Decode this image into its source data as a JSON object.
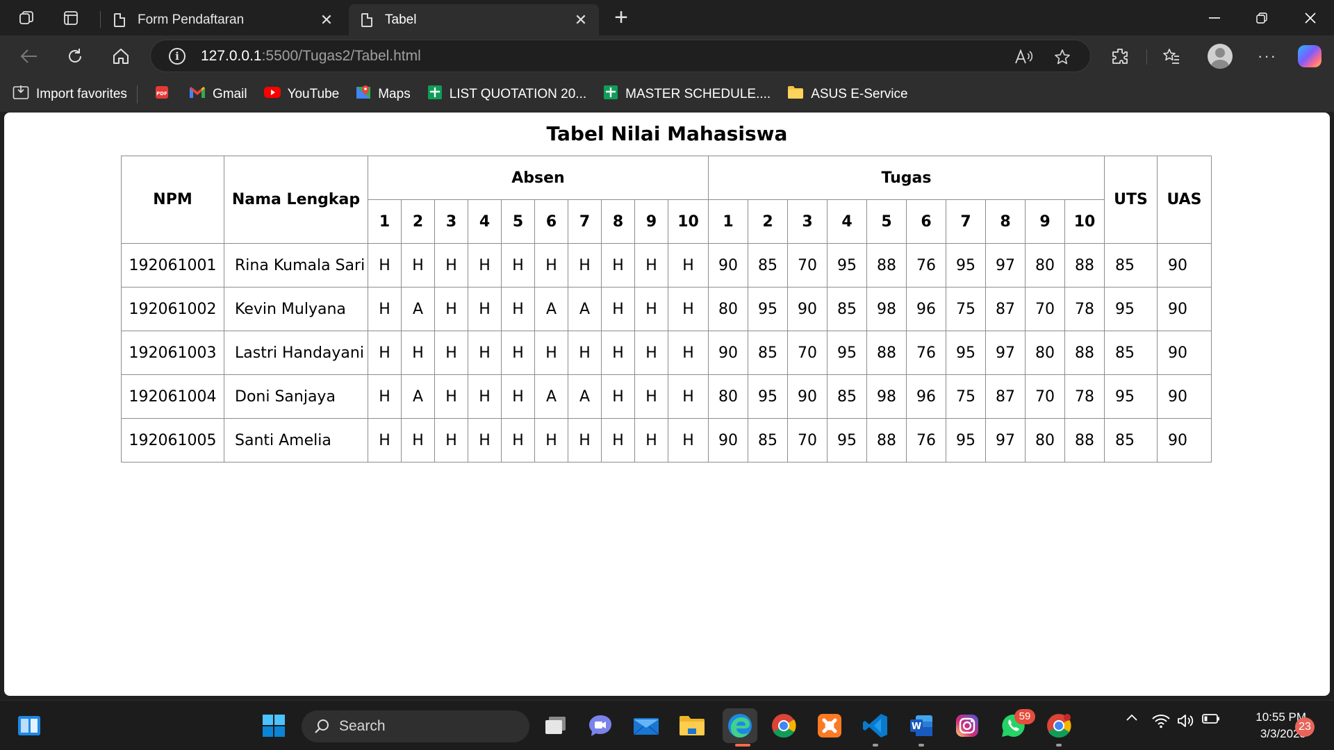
{
  "browser": {
    "tabs": [
      {
        "title": "Form Pendaftaran",
        "close": "✕"
      },
      {
        "title": "Tabel",
        "close": "✕"
      }
    ],
    "new_tab": "+",
    "address": {
      "host": "127.0.0.1",
      "path": ":5500/Tugas2/Tabel.html"
    },
    "window_controls": {
      "minimize": "—",
      "restore": "❐",
      "close": "✕"
    },
    "favorites": [
      {
        "label": "Import favorites",
        "icon": "import-icon"
      },
      {
        "label": "",
        "icon": "pdf-icon"
      },
      {
        "label": "Gmail",
        "icon": "gmail-icon"
      },
      {
        "label": "YouTube",
        "icon": "youtube-icon"
      },
      {
        "label": "Maps",
        "icon": "maps-icon"
      },
      {
        "label": "LIST QUOTATION 20...",
        "icon": "sheets-icon"
      },
      {
        "label": "MASTER SCHEDULE....",
        "icon": "sheets-icon"
      },
      {
        "label": "ASUS E-Service",
        "icon": "folder-icon"
      }
    ]
  },
  "page": {
    "title": "Tabel Nilai Mahasiswa",
    "headers": {
      "npm": "NPM",
      "name": "Nama Lengkap",
      "absen": "Absen",
      "tugas": "Tugas",
      "uts": "UTS",
      "uas": "UAS",
      "absen_cols": [
        "1",
        "2",
        "3",
        "4",
        "5",
        "6",
        "7",
        "8",
        "9",
        "10"
      ],
      "tugas_cols": [
        "1",
        "2",
        "3",
        "4",
        "5",
        "6",
        "7",
        "8",
        "9",
        "10"
      ]
    },
    "rows": [
      {
        "npm": "192061001",
        "name": "Rina Kumala Sari",
        "absen": [
          "H",
          "H",
          "H",
          "H",
          "H",
          "H",
          "H",
          "H",
          "H",
          "H"
        ],
        "tugas": [
          "90",
          "85",
          "70",
          "95",
          "88",
          "76",
          "95",
          "97",
          "80",
          "88"
        ],
        "uts": "85",
        "uas": "90"
      },
      {
        "npm": "192061002",
        "name": "Kevin Mulyana",
        "absen": [
          "H",
          "A",
          "H",
          "H",
          "H",
          "A",
          "A",
          "H",
          "H",
          "H"
        ],
        "tugas": [
          "80",
          "95",
          "90",
          "85",
          "98",
          "96",
          "75",
          "87",
          "70",
          "78"
        ],
        "uts": "95",
        "uas": "90"
      },
      {
        "npm": "192061003",
        "name": "Lastri Handayani",
        "absen": [
          "H",
          "H",
          "H",
          "H",
          "H",
          "H",
          "H",
          "H",
          "H",
          "H"
        ],
        "tugas": [
          "90",
          "85",
          "70",
          "95",
          "88",
          "76",
          "95",
          "97",
          "80",
          "88"
        ],
        "uts": "85",
        "uas": "90"
      },
      {
        "npm": "192061004",
        "name": "Doni Sanjaya",
        "absen": [
          "H",
          "A",
          "H",
          "H",
          "H",
          "A",
          "A",
          "H",
          "H",
          "H"
        ],
        "tugas": [
          "80",
          "95",
          "90",
          "85",
          "98",
          "96",
          "75",
          "87",
          "70",
          "78"
        ],
        "uts": "95",
        "uas": "90"
      },
      {
        "npm": "192061005",
        "name": "Santi Amelia",
        "absen": [
          "H",
          "H",
          "H",
          "H",
          "H",
          "H",
          "H",
          "H",
          "H",
          "H"
        ],
        "tugas": [
          "90",
          "85",
          "70",
          "95",
          "88",
          "76",
          "95",
          "97",
          "80",
          "88"
        ],
        "uts": "85",
        "uas": "90"
      }
    ]
  },
  "taskbar": {
    "search_label": "Search",
    "whatsapp_badge": "59",
    "notification_count": "23",
    "time": "10:55 PM",
    "date": "3/3/2025"
  }
}
